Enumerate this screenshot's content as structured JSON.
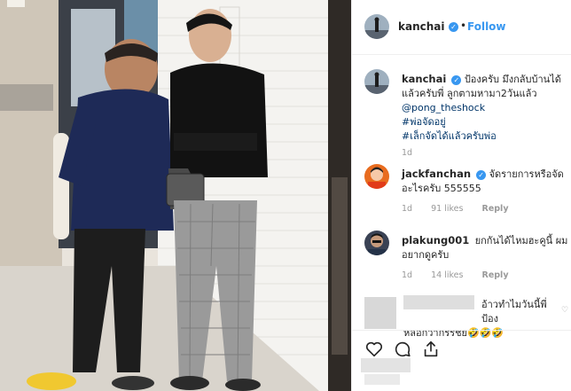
{
  "post": {
    "username": "kanchai",
    "follow_label": "Follow",
    "separator": "•",
    "verified_glyph": "✓"
  },
  "caption": {
    "username": "kanchai",
    "text": "ป้องครับ มึงกลับบ้านได้แล้วครับพี่ ลูกตามหามา2วันแล้ว",
    "mention": "@pong_theshock",
    "tag1": "#พ่อจัดอยู่",
    "tag2": "#เล็กจัดได้แล้วครับพ่อ",
    "time": "1d"
  },
  "comments": [
    {
      "username": "jackfanchan",
      "text": "จัดรายการหรือจัดอะไรครับ 555555",
      "time": "1d",
      "likes": "91 likes",
      "reply_label": "Reply",
      "avatar_icon": "orange-avatar-icon"
    },
    {
      "username": "plakung001",
      "text": "ยกกันได้ไหมฮะคูนี้ ผมอยากดูครับ",
      "time": "1d",
      "likes": "14 likes",
      "reply_label": "Reply",
      "avatar_icon": "man-avatar-icon"
    },
    {
      "username": "",
      "text1": "อ้าวทำไมวันนี้พี่ป้อง",
      "text2": "หลอกวากรรชย🤣🤣🤣",
      "avatar_icon": "blurred-avatar"
    }
  ],
  "actions": {
    "like_icon": "heart-icon",
    "comment_icon": "comment-icon",
    "share_icon": "share-icon"
  },
  "colors": {
    "link": "#003569",
    "accent": "#3897f0",
    "muted": "#999999"
  }
}
